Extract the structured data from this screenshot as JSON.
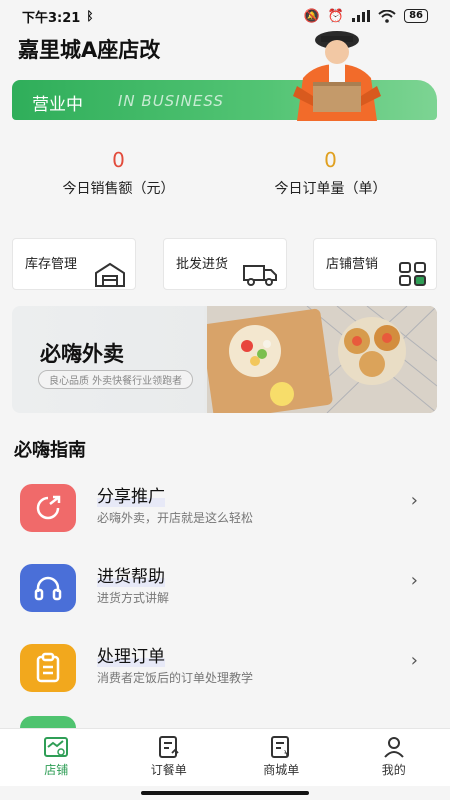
{
  "status_bar": {
    "time": "下午3:21",
    "battery": "86"
  },
  "store": {
    "name": "嘉里城A座店改"
  },
  "banner": {
    "status_cn": "营业中",
    "status_en": "IN BUSINESS"
  },
  "stats": [
    {
      "value": "0",
      "label": "今日销售额（元）",
      "color": "#e24b3b"
    },
    {
      "value": "0",
      "label": "今日订单量（单）",
      "color": "#e0a020"
    }
  ],
  "quick_actions": [
    {
      "label": "库存管理",
      "icon": "warehouse-icon"
    },
    {
      "label": "批发进货",
      "icon": "truck-icon"
    },
    {
      "label": "店铺营销",
      "icon": "grid-icon"
    }
  ],
  "promo": {
    "title": "必嗨外卖",
    "subtitle": "良心品质 外卖快餐行业领跑者"
  },
  "guide": {
    "title": "必嗨指南",
    "items": [
      {
        "title": "分享推广",
        "subtitle": "必嗨外卖，开店就是这么轻松",
        "icon": "share-icon",
        "color": "#f06a6a"
      },
      {
        "title": "进货帮助",
        "subtitle": "进货方式讲解",
        "icon": "headphones-icon",
        "color": "#4a6fd8"
      },
      {
        "title": "处理订单",
        "subtitle": "消费者定饭后的订单处理教学",
        "icon": "clipboard-icon",
        "color": "#f2a81d"
      }
    ]
  },
  "tabs": [
    {
      "label": "店铺",
      "icon": "store-icon",
      "active": true
    },
    {
      "label": "订餐单",
      "icon": "order-icon",
      "active": false
    },
    {
      "label": "商城单",
      "icon": "mall-order-icon",
      "active": false
    },
    {
      "label": "我的",
      "icon": "profile-icon",
      "active": false
    }
  ],
  "colors": {
    "accent": "#2f9e56",
    "banner": "#3cb567"
  }
}
